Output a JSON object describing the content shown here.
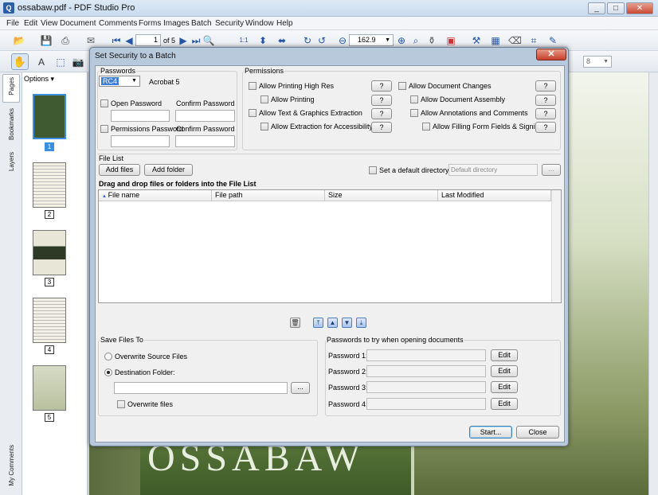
{
  "window": {
    "title": "ossabaw.pdf - PDF Studio Pro",
    "min": "_",
    "max": "□",
    "close": "✕"
  },
  "menu": [
    "File",
    "Edit",
    "View",
    "Document",
    "Comments",
    "Forms",
    "Images",
    "Batch",
    "Security",
    "Window",
    "Help"
  ],
  "toolbar": {
    "page_current": "1",
    "page_total": "of 5",
    "zoom": "162.9",
    "font_size": "8"
  },
  "left_tabs": {
    "pages": "Pages",
    "bookmarks": "Bookmarks",
    "layers": "Layers",
    "comments": "My Comments"
  },
  "thumbs": {
    "options": "Options",
    "pages": [
      "1",
      "2",
      "3",
      "4",
      "5"
    ]
  },
  "document": {
    "visible_text": "OSSABAW"
  },
  "dialog": {
    "title": "Set Security to a Batch",
    "passwords": {
      "legend": "Passwords",
      "encryption": "RC4",
      "compat": "Acrobat 5",
      "open_password": "Open Password",
      "confirm_password": "Confirm Password",
      "permissions_password": "Permissions Password",
      "confirm_password2": "Confirm Password"
    },
    "permissions": {
      "legend": "Permissions",
      "items": [
        "Allow Printing High Res",
        "Allow Printing",
        "Allow Text & Graphics Extraction",
        "Allow Extraction for Accessibility",
        "Allow Document Changes",
        "Allow Document Assembly",
        "Allow Annotations and Comments",
        "Allow Filling Form Fields & Signing"
      ],
      "help": "?"
    },
    "file_list": {
      "legend": "File List",
      "add_files": "Add files",
      "add_folder": "Add folder",
      "default_dir_label": "Set a default directory",
      "default_dir_placeholder": "Default directory",
      "browse": "...",
      "drag_hint": "Drag and drop files or folders into the File List",
      "columns": [
        "File name",
        "File path",
        "Size",
        "Last Modified"
      ]
    },
    "save_to": {
      "legend": "Save Files To",
      "overwrite": "Overwrite Source Files",
      "destination": "Destination Folder:",
      "browse": "...",
      "overwrite_files": "Overwrite files"
    },
    "try_passwords": {
      "legend": "Passwords to try when opening documents",
      "rows": [
        "Password 1:",
        "Password 2:",
        "Password 3:",
        "Password 4:"
      ],
      "edit": "Edit"
    },
    "start": "Start...",
    "close": "Close"
  }
}
